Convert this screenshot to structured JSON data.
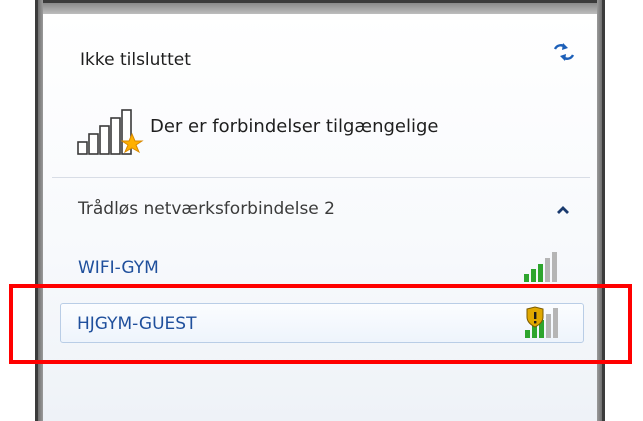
{
  "status": {
    "title": "Ikke tilsluttet",
    "refresh_icon": "refresh-arrows-icon"
  },
  "availability": {
    "message": "Der er forbindelser tilgængelige",
    "icon": "network-bars-star-icon"
  },
  "section": {
    "title": "Trådløs netværksforbindelse 2",
    "toggle_icon": "chevron-up-icon"
  },
  "networks": [
    {
      "name": "WIFI-GYM",
      "signal_bars": 5,
      "secured": false
    },
    {
      "name": "HJGYM-GUEST",
      "signal_bars": 5,
      "secured": true
    }
  ],
  "colors": {
    "link": "#1f4f9c",
    "highlight": "#ff0000",
    "signal_green": "#2ea52e",
    "signal_grey": "#b5b5b5",
    "star_orange": "#ffb000",
    "shield_gold": "#e0a800"
  }
}
